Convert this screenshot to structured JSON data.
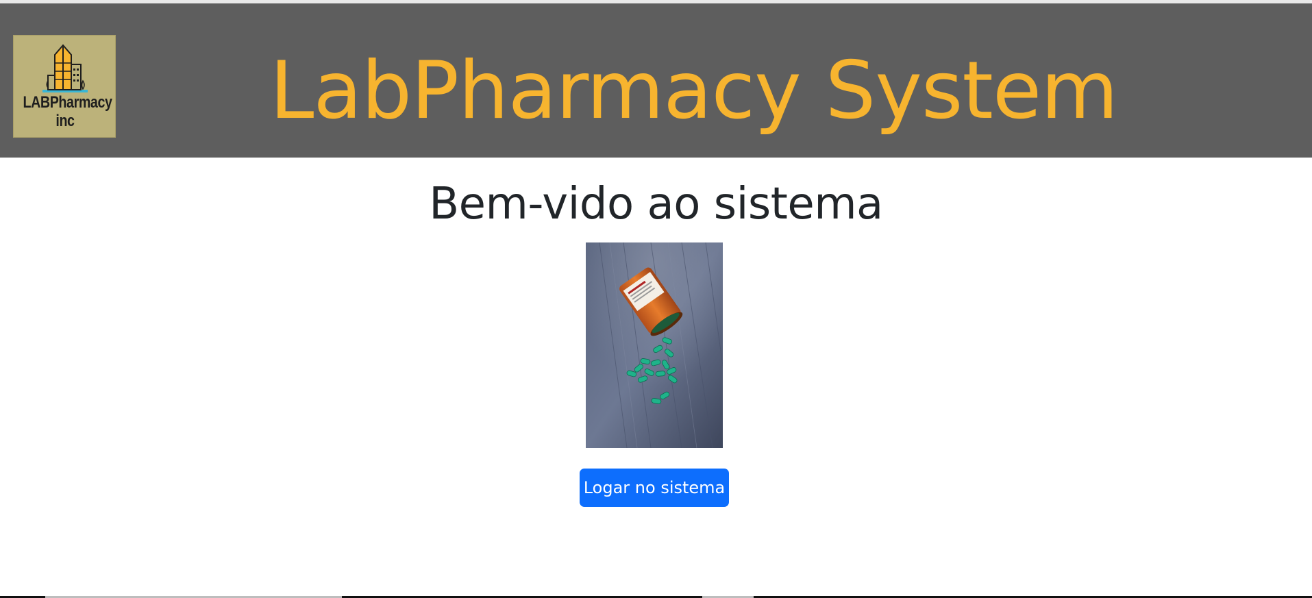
{
  "header": {
    "logo": {
      "line1": "LABPharmacy",
      "line2": "inc",
      "icon": "building-icon",
      "bg_color": "#bcb27a"
    },
    "title": "LabPharmacy System",
    "bg_color": "#5e5e5e",
    "title_color": "#f7b42f"
  },
  "main": {
    "welcome": "Bem-vido ao sistema",
    "image": "pill-bottle-photo",
    "login_button": "Logar no sistema",
    "button_color": "#0d6efd"
  }
}
